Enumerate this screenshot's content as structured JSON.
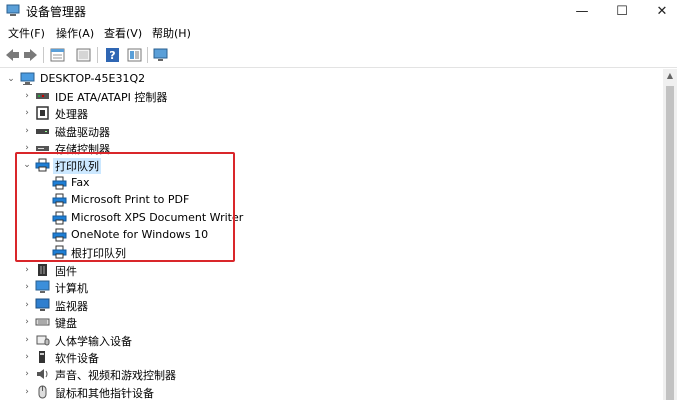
{
  "window": {
    "title": "设备管理器",
    "minimize": "—",
    "maximize": "☐",
    "close": "✕"
  },
  "menu": [
    "文件(F)",
    "操作(A)",
    "查看(V)",
    "帮助(H)"
  ],
  "toolbar": {
    "icons": [
      "back-icon",
      "forward-icon",
      "properties-icon",
      "device-list-icon",
      "help-icon",
      "show-device-icon",
      "monitor-icon"
    ]
  },
  "tree": {
    "root": "DESKTOP-45E31Q2",
    "categories": [
      {
        "label": "IDE ATA/ATAPI 控制器",
        "icon": "ide-controller-icon"
      },
      {
        "label": "处理器",
        "icon": "processor-icon"
      },
      {
        "label": "磁盘驱动器",
        "icon": "disk-drive-icon"
      },
      {
        "label": "存储控制器",
        "icon": "storage-controller-icon"
      },
      {
        "label": "打印队列",
        "icon": "printer-icon",
        "expanded": true,
        "selected": true,
        "children": [
          "Fax",
          "Microsoft Print to PDF",
          "Microsoft XPS Document Writer",
          "OneNote for Windows 10",
          "根打印队列"
        ]
      },
      {
        "label": "固件",
        "icon": "firmware-icon"
      },
      {
        "label": "计算机",
        "icon": "computer-icon"
      },
      {
        "label": "监视器",
        "icon": "monitor-icon"
      },
      {
        "label": "键盘",
        "icon": "keyboard-icon"
      },
      {
        "label": "人体学输入设备",
        "icon": "hid-icon"
      },
      {
        "label": "软件设备",
        "icon": "software-device-icon"
      },
      {
        "label": "声音、视频和游戏控制器",
        "icon": "audio-icon"
      },
      {
        "label": "鼠标和其他指针设备",
        "icon": "mouse-icon"
      }
    ]
  },
  "colors": {
    "highlight": "#d9262a",
    "selection": "#cce8ff",
    "printer": "#1e7fd6"
  }
}
